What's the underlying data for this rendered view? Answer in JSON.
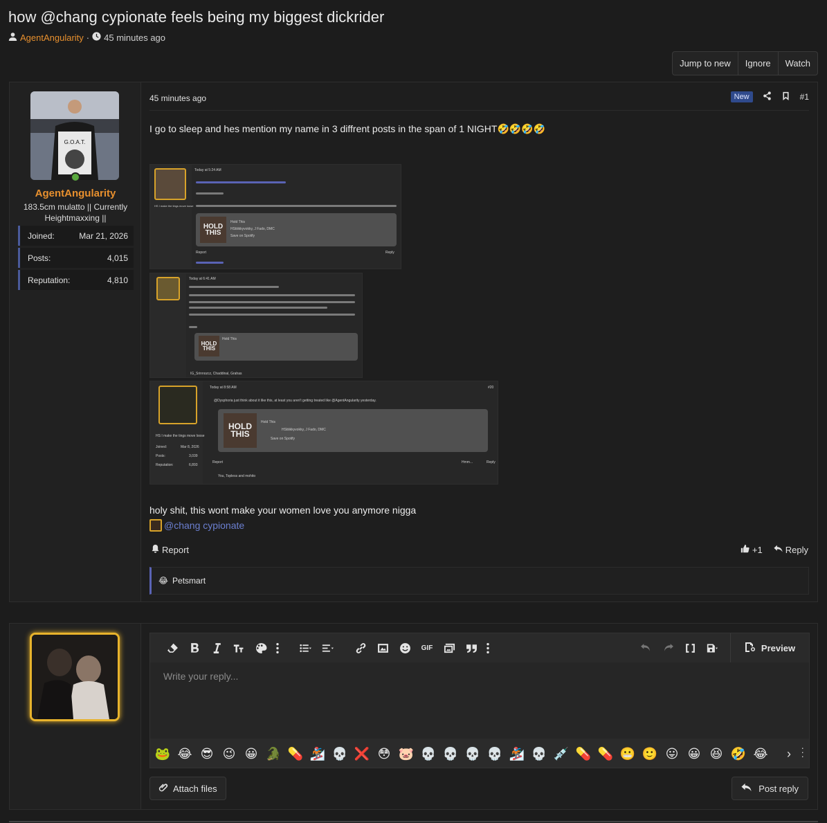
{
  "thread": {
    "title": "how @chang cypionate feels being my biggest dickrider",
    "author": "AgentAngularity",
    "separator": "·",
    "time": "45 minutes ago"
  },
  "thread_actions": [
    "Jump to new",
    "Ignore",
    "Watch"
  ],
  "post": {
    "user": {
      "name": "AgentAngularity",
      "title": "183.5cm mulatto || Currently Heightmaxxing ||",
      "stats": [
        {
          "label": "Joined:",
          "value": "Mar 21, 2026"
        },
        {
          "label": "Posts:",
          "value": "4,015"
        },
        {
          "label": "Reputation:",
          "value": "4,810"
        }
      ]
    },
    "time": "45 minutes ago",
    "badge": "New",
    "number": "#1",
    "text1": "I go to sleep and hes mention my name in 3 diffrent posts in the span of 1 NIGHT🤣🤣🤣🤣",
    "text2": "holy shit, this wont make your women love you anymore nigga",
    "mention": "@chang cypionate",
    "report_label": "Report",
    "like_count": "+1",
    "reply_label": "Reply",
    "reaction_emoji": "😂",
    "reaction_user": "Petsmart",
    "screenshots": {
      "s1": {
        "time": "Today at 5:24 AM",
        "name": "HS I make the tings move loose",
        "card_title": "Hold This",
        "card_artist": "HStiiikkyvokky, J Fado, DMC",
        "card_action": "Save on Spotify",
        "cover": "HOLD THIS",
        "report": "Report",
        "reply": "Reply"
      },
      "s2": {
        "time": "Today at 6:41 AM",
        "card_title": "Hold This",
        "cover": "HOLD THIS",
        "footer": "IG_Srinnozcz, Chaddinal, Grahas"
      },
      "s3": {
        "time": "Today at 8:58 AM",
        "number": "#20",
        "quote": "@Dysphoria just think about it like this, at least you aren't getting treated like @AgentAngularity yesterday.",
        "card_title": "Hold This",
        "card_artist": "HStiiikkyvokky, J Fado, DMC",
        "card_action": "Save on Spotify",
        "cover": "HOLD THIS",
        "name": "HS I make the tings move loose",
        "joined_label": "Joined:",
        "joined": "Mar 8, 2026",
        "posts_label": "Posts:",
        "posts": "3,039",
        "rep_label": "Reputation:",
        "rep": "6,893",
        "report": "Report",
        "reply": "Reply",
        "reaction": "Hmm...",
        "footer": "You, Topless and mohito"
      }
    }
  },
  "editor": {
    "placeholder": "Write your reply...",
    "preview_label": "Preview",
    "gif_label": "GIF",
    "smilies": [
      "🐸",
      "😂",
      "😎",
      "😉",
      "😀",
      "🐊",
      "💊",
      "🏂",
      "💀",
      "❌",
      "😳",
      "🐷",
      "💀",
      "💀",
      "💀",
      "💀",
      "🏂",
      "💀",
      "💉",
      "💊",
      "💊",
      "😬",
      "🙂",
      "😛",
      "😀",
      "😆",
      "🤣",
      "😂"
    ]
  },
  "attach_label": "Attach files",
  "post_reply_label": "Post reply"
}
